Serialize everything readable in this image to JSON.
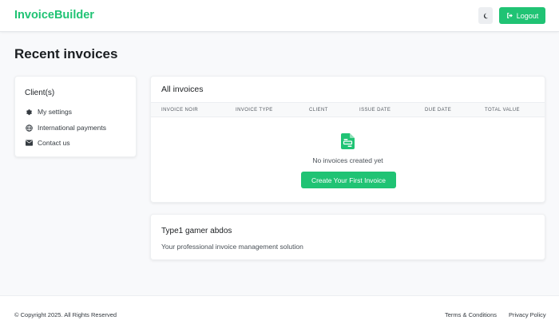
{
  "navbar": {
    "brand": "InvoiceBuilder",
    "theme_icon": "moon-icon",
    "logout_icon": "logout-icon",
    "logout_label": "Logout"
  },
  "page": {
    "title": "Recent invoices"
  },
  "sidebar": {
    "title": "Client(s)",
    "items": [
      {
        "label": "My settings",
        "icon": "gear-icon"
      },
      {
        "label": "International payments",
        "icon": "globe-icon"
      },
      {
        "label": "Contact us",
        "icon": "envelope-icon"
      }
    ]
  },
  "invoices": {
    "title": "All invoices",
    "columns": [
      "INVOICE NOIR",
      "INVOICE TYPE",
      "CLIENT",
      "ISSUE DATE",
      "DUE DATE",
      "TOTAL VALUE"
    ],
    "empty_icon": "invoice-file-icon",
    "empty_text": "No invoices created yet",
    "create_label": "Create Your First Invoice"
  },
  "info": {
    "title": "Type1 gamer abdos",
    "subtitle": "Your professional invoice management solution"
  },
  "footer": {
    "copyright": "© Copyright 2025. All Rights Reserved",
    "links": [
      "Terms & Conditions",
      "Privacy Policy"
    ]
  },
  "colors": {
    "accent": "#20c374",
    "background": "#f8f9fb"
  }
}
